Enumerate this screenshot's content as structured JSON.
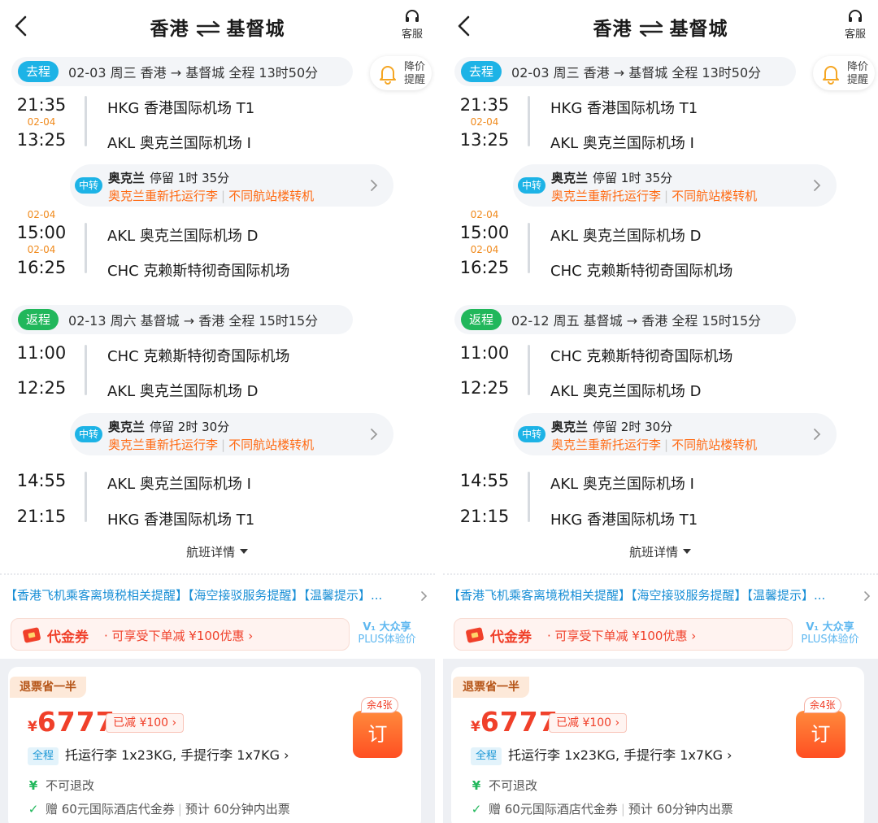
{
  "phones": [
    {
      "header": {
        "title_from": "香港",
        "title_to": "基督城",
        "service_label": "客服"
      },
      "price_alert": {
        "line1": "降价",
        "line2": "提醒"
      },
      "outbound": {
        "tag": "去程",
        "info": "02-03 周三   香港 → 基督城   全程 13时50分",
        "flights": [
          {
            "date": "",
            "time": "21:35",
            "airport": "HKG 香港国际机场 T1"
          },
          {
            "date": "02-04",
            "time": "13:25",
            "airport": "AKL 奥克兰国际机场 I"
          },
          {
            "date": "02-04",
            "time": "15:00",
            "airport": "AKL 奥克兰国际机场 D"
          },
          {
            "date": "02-04",
            "time": "16:25",
            "airport": "CHC 克赖斯特彻奇国际机场"
          }
        ],
        "transfer": {
          "badge": "中转",
          "city": "奥克兰",
          "stay": "停留 1时 35分",
          "note1": "奥克兰重新托运行李",
          "note2": "不同航站楼转机"
        }
      },
      "return": {
        "tag": "返程",
        "info": "02-13 周六   基督城 → 香港   全程 15时15分",
        "flights": [
          {
            "date": "",
            "time": "11:00",
            "airport": "CHC 克赖斯特彻奇国际机场"
          },
          {
            "date": "",
            "time": "12:25",
            "airport": "AKL 奥克兰国际机场 D"
          },
          {
            "date": "",
            "time": "14:55",
            "airport": "AKL 奥克兰国际机场 I"
          },
          {
            "date": "",
            "time": "21:15",
            "airport": "HKG 香港国际机场 T1"
          }
        ],
        "transfer": {
          "badge": "中转",
          "city": "奥克兰",
          "stay": "停留 2时 30分",
          "note1": "奥克兰重新托运行李",
          "note2": "不同航站楼转机"
        }
      },
      "flight_detail": "航班详情",
      "notice": "【香港飞机乘客离境税相关提醒】【海空接驳服务提醒】【温馨提示】...",
      "coupon": {
        "title": "代金券",
        "desc": "· 可享受下单减 ¥100优惠  ›"
      },
      "plus": {
        "line1": "V₁ 大众享",
        "line2": "PLUS体验价"
      },
      "card": {
        "refund_tag": "退票省一半",
        "currency": "¥",
        "price": "6777",
        "discount": "已减  ¥100 ›",
        "seats": "余4张",
        "order": "订",
        "scope": "全程",
        "baggage": "托运行李 1x23KG,  手提行李 1x7KG ›",
        "rule1": "不可退改",
        "rule2a": "赠 60元国际酒店代金券",
        "rule2b": "预计 60分钟内出票"
      }
    },
    {
      "header": {
        "title_from": "香港",
        "title_to": "基督城",
        "service_label": "客服"
      },
      "price_alert": {
        "line1": "降价",
        "line2": "提醒"
      },
      "outbound": {
        "tag": "去程",
        "info": "02-03 周三   香港 → 基督城   全程 13时50分",
        "flights": [
          {
            "date": "",
            "time": "21:35",
            "airport": "HKG 香港国际机场 T1"
          },
          {
            "date": "02-04",
            "time": "13:25",
            "airport": "AKL 奥克兰国际机场 I"
          },
          {
            "date": "02-04",
            "time": "15:00",
            "airport": "AKL 奥克兰国际机场 D"
          },
          {
            "date": "02-04",
            "time": "16:25",
            "airport": "CHC 克赖斯特彻奇国际机场"
          }
        ],
        "transfer": {
          "badge": "中转",
          "city": "奥克兰",
          "stay": "停留 1时 35分",
          "note1": "奥克兰重新托运行李",
          "note2": "不同航站楼转机"
        }
      },
      "return": {
        "tag": "返程",
        "info": "02-12 周五   基督城 → 香港   全程 15时15分",
        "flights": [
          {
            "date": "",
            "time": "11:00",
            "airport": "CHC 克赖斯特彻奇国际机场"
          },
          {
            "date": "",
            "time": "12:25",
            "airport": "AKL 奥克兰国际机场 D"
          },
          {
            "date": "",
            "time": "14:55",
            "airport": "AKL 奥克兰国际机场 I"
          },
          {
            "date": "",
            "time": "21:15",
            "airport": "HKG 香港国际机场 T1"
          }
        ],
        "transfer": {
          "badge": "中转",
          "city": "奥克兰",
          "stay": "停留 2时 30分",
          "note1": "奥克兰重新托运行李",
          "note2": "不同航站楼转机"
        }
      },
      "flight_detail": "航班详情",
      "notice": "【香港飞机乘客离境税相关提醒】【海空接驳服务提醒】【温馨提示】...",
      "coupon": {
        "title": "代金券",
        "desc": "· 可享受下单减 ¥100优惠  ›"
      },
      "plus": {
        "line1": "V₁ 大众享",
        "line2": "PLUS体验价"
      },
      "card": {
        "refund_tag": "退票省一半",
        "currency": "¥",
        "price": "6777",
        "discount": "已减  ¥100 ›",
        "seats": "余4张",
        "order": "订",
        "scope": "全程",
        "baggage": "托运行李 1x23KG,  手提行李 1x7KG ›",
        "rule1": "不可退改",
        "rule2a": "赠 60元国际酒店代金券",
        "rule2b": "预计 60分钟内出票"
      }
    }
  ],
  "colors": {
    "accent_blue": "#1db3e6",
    "return_green": "#21b75b",
    "alert_orange": "#ff6a13",
    "price_red": "#f0402a"
  },
  "icons": [
    "back-arrow-icon",
    "swap-arrows-icon",
    "headset-icon",
    "bell-icon",
    "chevron-right-icon",
    "caret-down-icon",
    "coupon-icon",
    "yen-icon",
    "check-icon"
  ]
}
